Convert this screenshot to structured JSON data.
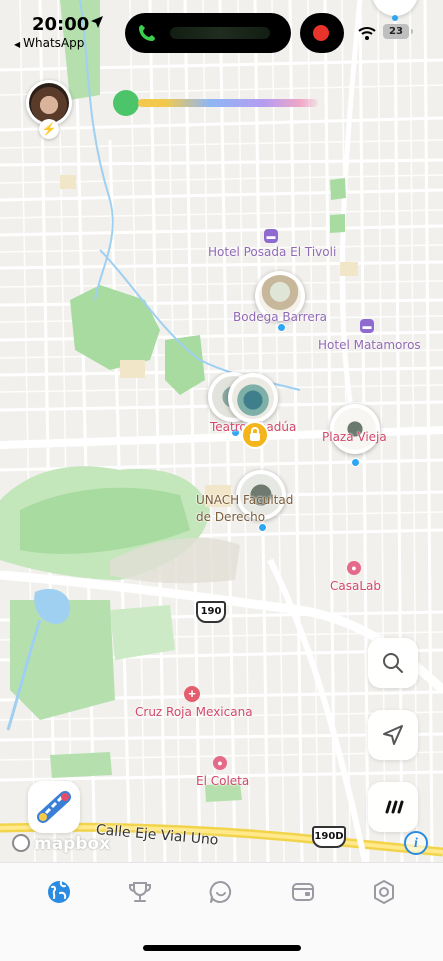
{
  "status_bar": {
    "time": "20:00",
    "back_app": "WhatsApp",
    "battery": "23"
  },
  "map": {
    "places": [
      {
        "name": "Hotel Posada El Tivoli",
        "color": "#9169b5"
      },
      {
        "name": "Bodega Barrera",
        "color": "#9169b5"
      },
      {
        "name": "Hotel Matamoros",
        "color": "#9169b5"
      },
      {
        "name": "Teatro Abadúa",
        "color": "#d2486b"
      },
      {
        "name": "Plaza Vieja",
        "color": "#d2486b"
      },
      {
        "name": "UNACH Facultad de Derecho",
        "color": "#7a5d3b"
      },
      {
        "name": "CasaLab",
        "color": "#d2486b"
      },
      {
        "name": "Cruz Roja Mexicana",
        "color": "#d2486b"
      },
      {
        "name": "El Coleta",
        "color": "#d2486b"
      }
    ],
    "highway_shields": [
      "190",
      "190D"
    ],
    "road_label": "Calle Eje Vial Uno",
    "attribution": "mapbox"
  },
  "map_controls": {
    "search_icon": "search-icon",
    "locate_icon": "location-arrow-icon",
    "more_icon": "more-dots-icon",
    "info_label": "i"
  },
  "bottom_nav": {
    "items": [
      {
        "icon": "globe-icon",
        "active": true
      },
      {
        "icon": "trophy-icon",
        "active": false
      },
      {
        "icon": "chat-icon",
        "active": false
      },
      {
        "icon": "wallet-icon",
        "active": false
      },
      {
        "icon": "settings-icon",
        "active": false
      }
    ]
  },
  "colors": {
    "accent": "#2a8be0",
    "map_background": "#f0efeb",
    "park": "#a8dba0",
    "water": "#9fd0f2",
    "highway": "#f2d44c"
  }
}
